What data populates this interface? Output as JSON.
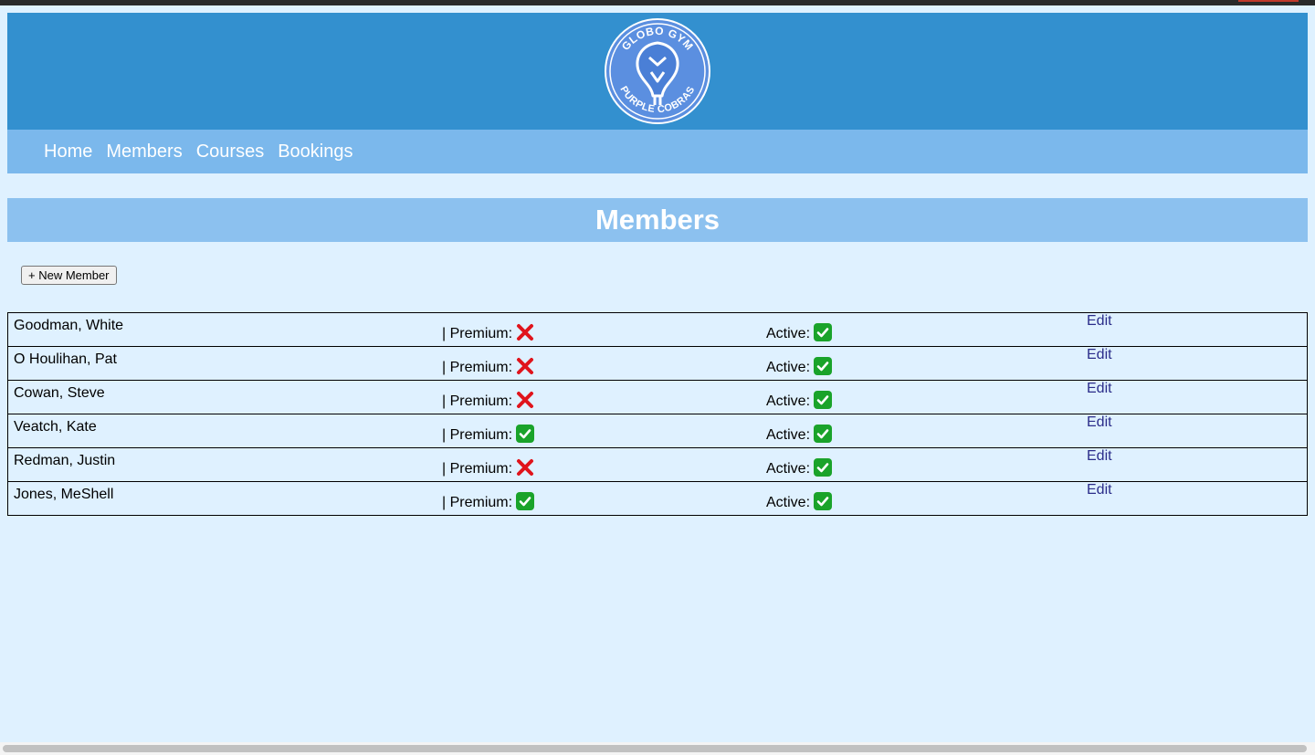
{
  "logo": {
    "top_text": "GLOBO GYM",
    "bottom_text": "PURPLE COBRAS"
  },
  "nav": {
    "items": [
      {
        "label": "Home"
      },
      {
        "label": "Members"
      },
      {
        "label": "Courses"
      },
      {
        "label": "Bookings"
      }
    ]
  },
  "page": {
    "title": "Members",
    "new_member_label": "+ New Member"
  },
  "members": [
    {
      "name": "Goodman, White",
      "premium_label": "| Premium:",
      "premium": false,
      "active_label": "Active:",
      "active": true,
      "edit_label": "Edit"
    },
    {
      "name": "O Houlihan, Pat",
      "premium_label": "| Premium:",
      "premium": false,
      "active_label": "Active:",
      "active": true,
      "edit_label": "Edit"
    },
    {
      "name": "Cowan, Steve",
      "premium_label": "| Premium:",
      "premium": false,
      "active_label": "Active:",
      "active": true,
      "edit_label": "Edit"
    },
    {
      "name": "Veatch, Kate",
      "premium_label": "| Premium:",
      "premium": true,
      "active_label": "Active:",
      "active": true,
      "edit_label": "Edit"
    },
    {
      "name": "Redman, Justin",
      "premium_label": "| Premium:",
      "premium": false,
      "active_label": "Active:",
      "active": true,
      "edit_label": "Edit"
    },
    {
      "name": "Jones, MeShell",
      "premium_label": "| Premium:",
      "premium": true,
      "active_label": "Active:",
      "active": true,
      "edit_label": "Edit"
    }
  ],
  "icons": {
    "yes": "check-mark-icon",
    "no": "cross-mark-icon"
  },
  "colors": {
    "background": "#dff1ff",
    "header": "#3390cf",
    "nav": "#7bb8ec",
    "title_bar": "#8cc1ef",
    "check_green": "#1aa32a",
    "cross_red": "#e0141c",
    "edit_link": "#2b2d8a"
  }
}
